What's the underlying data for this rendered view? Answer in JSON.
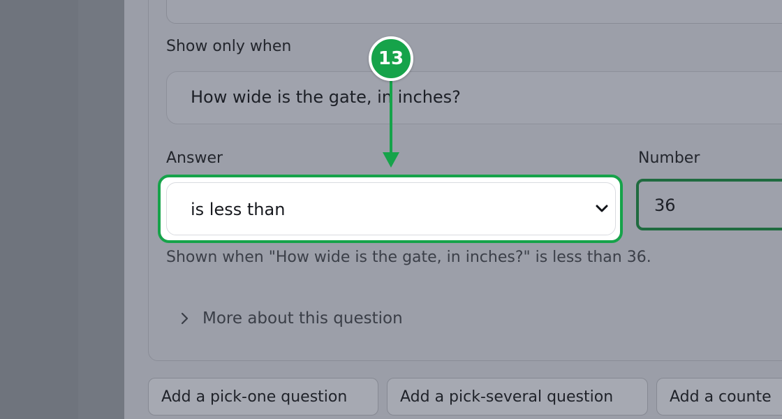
{
  "condition": {
    "show_only_when_label": "Show only when",
    "question_value": "How wide is the gate, in inches?",
    "answer_label": "Answer",
    "answer_selected": "is less than",
    "number_label": "Number",
    "number_value": "36",
    "hint": "Shown when \"How wide is the gate, in inches?\" is less than 36."
  },
  "details": {
    "label": "More about this question"
  },
  "add_buttons": [
    {
      "label": "Add a pick-one question"
    },
    {
      "label": "Add a pick-several question"
    },
    {
      "label": "Add a counte"
    }
  ],
  "callout": {
    "step_number": "13",
    "color": "#16a34a"
  },
  "icons": {
    "select": "chevron-down-icon",
    "details": "chevron-right-icon"
  }
}
